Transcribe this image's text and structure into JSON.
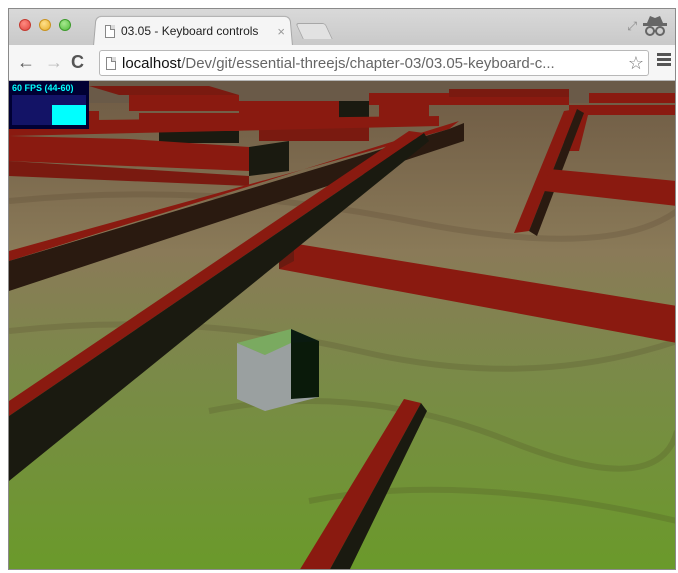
{
  "browser": {
    "tab_title": "03.05 - Keyboard controls",
    "tab_close": "×",
    "nav": {
      "back": "←",
      "forward": "→",
      "reload": "C"
    },
    "url_host": "localhost",
    "url_path": "/Dev/git/essential-threejs/chapter-03/03.05-keyboard-c...",
    "star": "☆"
  },
  "stats": {
    "fps_label": "60 FPS (44-60)",
    "colors": {
      "text": "#00ffff",
      "bg": "#000033",
      "graph": "#131366"
    }
  },
  "scene": {
    "floor_color": "#7a9a3a",
    "wall_color": "#8a1a10",
    "cube_color": "#8a9a80"
  }
}
